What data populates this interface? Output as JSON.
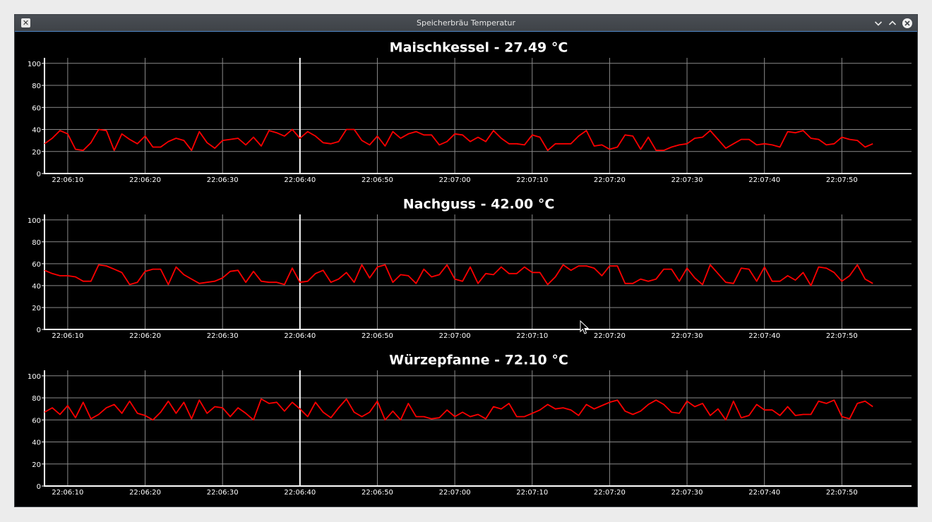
{
  "window": {
    "title": "Speicherbräu Temperatur",
    "icon": "x-app-icon",
    "buttons": [
      "minimize-icon",
      "maximize-icon",
      "close-icon"
    ]
  },
  "colors": {
    "background": "#000000",
    "grid": "#8a8a8a",
    "axis": "#ffffff",
    "line": "#ff0000",
    "text": "#ffffff"
  },
  "chart_data": [
    {
      "type": "line",
      "title": "Maischkessel - 27.49 °C",
      "xlabel": "",
      "ylabel": "",
      "ylim": [
        0,
        105
      ],
      "yticks": [
        0,
        20,
        40,
        60,
        80,
        100
      ],
      "xlim": [
        "22:06:07",
        "22:07:59"
      ],
      "xticks": [
        "22:06:10",
        "22:06:20",
        "22:06:30",
        "22:06:40",
        "22:06:50",
        "22:07:00",
        "22:07:10",
        "22:07:20",
        "22:07:30",
        "22:07:40",
        "22:07:50"
      ],
      "grid": true,
      "x_start": "22:06:07",
      "x_end": "22:07:54",
      "values": [
        27,
        32,
        39,
        36,
        22,
        21,
        28,
        40,
        39,
        21,
        36,
        31,
        27,
        34,
        24,
        24,
        29,
        32,
        30,
        21,
        38,
        28,
        23,
        30,
        31,
        32,
        26,
        33,
        25,
        39,
        37,
        34,
        40,
        32,
        38,
        34,
        28,
        27,
        29,
        40,
        40,
        30,
        26,
        34,
        25,
        38,
        32,
        36,
        38,
        35,
        35,
        26,
        29,
        36,
        35,
        29,
        33,
        29,
        39,
        32,
        27,
        27,
        26,
        35,
        33,
        21,
        27,
        27,
        27,
        34,
        39,
        25,
        26,
        22,
        24,
        35,
        34,
        22,
        33,
        21,
        21,
        24,
        26,
        27,
        32,
        33,
        39,
        31,
        23,
        27,
        31,
        31,
        26,
        27,
        26,
        24,
        38,
        37,
        39,
        32,
        31,
        26,
        27,
        33,
        31,
        30,
        24,
        27
      ]
    },
    {
      "type": "line",
      "title": "Nachguss - 42.00 °C",
      "xlabel": "",
      "ylabel": "",
      "ylim": [
        0,
        105
      ],
      "yticks": [
        0,
        20,
        40,
        60,
        80,
        100
      ],
      "xlim": [
        "22:06:07",
        "22:07:59"
      ],
      "xticks": [
        "22:06:10",
        "22:06:20",
        "22:06:30",
        "22:06:40",
        "22:06:50",
        "22:07:00",
        "22:07:10",
        "22:07:20",
        "22:07:30",
        "22:07:40",
        "22:07:50"
      ],
      "grid": true,
      "x_start": "22:06:07",
      "x_end": "22:07:54",
      "values": [
        54,
        51,
        49,
        49,
        48,
        44,
        44,
        59,
        58,
        55,
        52,
        41,
        43,
        53,
        55,
        55,
        41,
        57,
        50,
        46,
        42,
        43,
        44,
        47,
        53,
        54,
        43,
        53,
        44,
        43,
        43,
        41,
        56,
        43,
        44,
        51,
        54,
        43,
        46,
        52,
        43,
        59,
        47,
        57,
        59,
        43,
        50,
        49,
        42,
        55,
        48,
        50,
        59,
        46,
        44,
        57,
        42,
        51,
        50,
        57,
        51,
        51,
        57,
        52,
        52,
        41,
        48,
        59,
        54,
        58,
        58,
        56,
        49,
        58,
        58,
        42,
        42,
        46,
        44,
        46,
        55,
        55,
        44,
        56,
        47,
        41,
        59,
        51,
        43,
        42,
        56,
        55,
        44,
        57,
        44,
        44,
        49,
        45,
        52,
        40,
        57,
        56,
        52,
        44,
        49,
        59,
        46,
        42
      ]
    },
    {
      "type": "line",
      "title": "Würzepfanne - 72.10 °C",
      "xlabel": "",
      "ylabel": "",
      "ylim": [
        0,
        105
      ],
      "yticks": [
        0,
        20,
        40,
        60,
        80,
        100
      ],
      "xlim": [
        "22:06:07",
        "22:07:59"
      ],
      "xticks": [
        "22:06:10",
        "22:06:20",
        "22:06:30",
        "22:06:40",
        "22:06:50",
        "22:07:00",
        "22:07:10",
        "22:07:20",
        "22:07:30",
        "22:07:40",
        "22:07:50"
      ],
      "grid": true,
      "x_start": "22:06:07",
      "x_end": "22:07:54",
      "values": [
        67,
        71,
        65,
        73,
        62,
        76,
        61,
        65,
        71,
        74,
        66,
        77,
        66,
        64,
        60,
        67,
        77,
        66,
        76,
        61,
        78,
        66,
        72,
        71,
        63,
        71,
        66,
        60,
        79,
        75,
        76,
        68,
        76,
        70,
        63,
        76,
        67,
        62,
        71,
        79,
        67,
        63,
        67,
        77,
        60,
        68,
        60,
        75,
        63,
        63,
        61,
        62,
        69,
        63,
        67,
        63,
        65,
        61,
        72,
        70,
        75,
        63,
        63,
        66,
        69,
        74,
        70,
        71,
        69,
        64,
        74,
        70,
        73,
        76,
        78,
        68,
        65,
        68,
        74,
        78,
        74,
        67,
        66,
        77,
        72,
        75,
        64,
        70,
        60,
        77,
        62,
        64,
        74,
        69,
        69,
        64,
        72,
        64,
        65,
        65,
        77,
        75,
        78,
        63,
        61,
        75,
        77,
        72
      ]
    }
  ]
}
